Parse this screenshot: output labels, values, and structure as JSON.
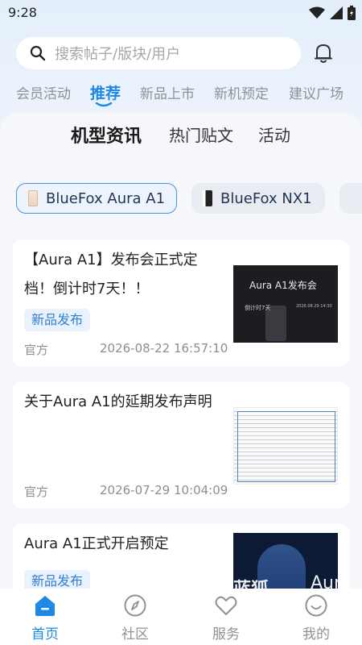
{
  "status": {
    "time": "9:28"
  },
  "search": {
    "placeholder": "搜索帖子/版块/用户",
    "icon": "search-icon"
  },
  "top_tabs": [
    {
      "label": "会员活动",
      "active": false
    },
    {
      "label": "推荐",
      "active": true
    },
    {
      "label": "新品上市",
      "active": false
    },
    {
      "label": "新机预定",
      "active": false
    },
    {
      "label": "建议广场",
      "active": false
    }
  ],
  "sub_tabs": [
    {
      "label": "机型资讯",
      "active": true
    },
    {
      "label": "热门贴文",
      "active": false
    },
    {
      "label": "活动",
      "active": false
    }
  ],
  "models": [
    {
      "label": "BlueFox Aura A1",
      "active": true
    },
    {
      "label": "BlueFox NX1",
      "active": false
    }
  ],
  "posts": [
    {
      "title": "【Aura A1】发布会正式定档！倒计时7天！！",
      "tag": "新品发布",
      "author": "官方",
      "time": "2026-08-22 16:57:10",
      "thumb": {
        "heading": "Aura A1发布会",
        "countdown": "倒计时7天",
        "date": "2026.08.29 14:30"
      }
    },
    {
      "title": "关于Aura A1的延期发布声明",
      "tag": "",
      "author": "官方",
      "time": "2026-07-29 10:04:09"
    },
    {
      "title": "Aura A1正式开启预定",
      "tag": "新品发布",
      "thumb": {
        "brand": "蓝狐",
        "model": "Aur"
      }
    }
  ],
  "bottom_nav": [
    {
      "label": "首页",
      "icon": "home-icon",
      "active": true
    },
    {
      "label": "社区",
      "icon": "compass-icon",
      "active": false
    },
    {
      "label": "服务",
      "icon": "heart-icon",
      "active": false
    },
    {
      "label": "我的",
      "icon": "smile-icon",
      "active": false
    }
  ],
  "colors": {
    "accent": "#1e88e5",
    "background": "#f5f7fb",
    "tag_bg": "#eaf2fd"
  }
}
